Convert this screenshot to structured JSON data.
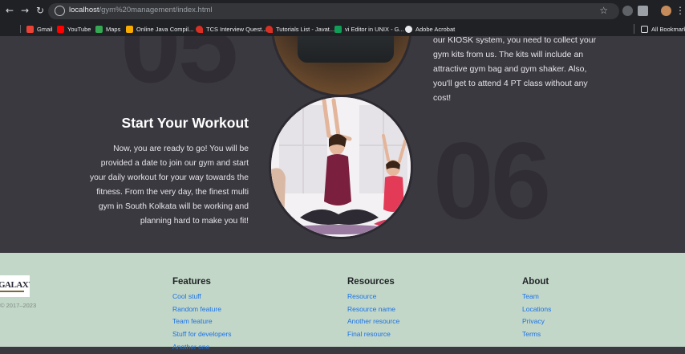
{
  "browser": {
    "url_host": "localhost",
    "url_path": "/gym%20management/index.html",
    "bookmarks": [
      {
        "label": "Gmail",
        "color": "#ea4335"
      },
      {
        "label": "YouTube",
        "color": "#ff0000"
      },
      {
        "label": "Maps",
        "color": "#34a853"
      },
      {
        "label": "Online Java Compil...",
        "color": "#f9ab00"
      },
      {
        "label": "TCS Interview Quest...",
        "color": "#d93025"
      },
      {
        "label": "Tutorials List - Javat...",
        "color": "#d93025"
      },
      {
        "label": "vi Editor in UNIX - G...",
        "color": "#0f9d58"
      },
      {
        "label": "Adobe Acrobat",
        "color": "#e8eaed"
      }
    ],
    "all_bookmarks": "All Bookmarks"
  },
  "hero": {
    "number_top": "05",
    "number_right": "06",
    "kiosk_text": "our KIOSK system, you need to collect your gym kits from us. The kits will include an attractive gym bag and gym shaker. Also, you'll get to attend 4 PT class without any cost!",
    "workout_title": "Start Your Workout",
    "workout_text": "Now, you are ready to go! You will be provided a date to join our gym and start your daily workout for your way towards the fitness. From the very day, the finest multi gym in South Kolkata will be working and planning hard to make you fit!"
  },
  "footer": {
    "logo_text": "GALAXY",
    "copyright": "© 2017–2023",
    "features": {
      "title": "Features",
      "links": [
        "Cool stuff",
        "Random feature",
        "Team feature",
        "Stuff for developers",
        "Another one"
      ]
    },
    "resources": {
      "title": "Resources",
      "links": [
        "Resource",
        "Resource name",
        "Another resource",
        "Final resource"
      ]
    },
    "about": {
      "title": "About",
      "links": [
        "Team",
        "Locations",
        "Privacy",
        "Terms"
      ]
    }
  }
}
